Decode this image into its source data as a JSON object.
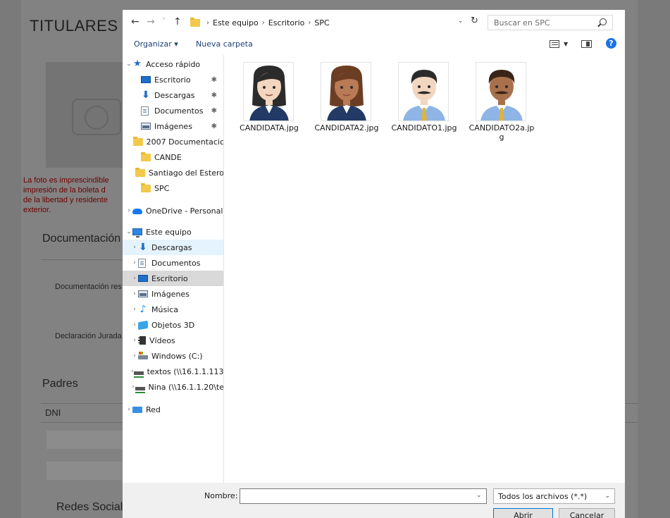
{
  "background_page": {
    "title": "TITULARES",
    "photo_warning": [
      "La foto es imprescindible",
      "impresión de la boleta d",
      "de la libertad y residente",
      "exterior."
    ],
    "section_documentacion": "Documentación",
    "label_doc_res": "Documentación res",
    "label_declaracion": "Declaración Jurada",
    "section_padres": "Padres",
    "label_dni": "DNI",
    "section_redes": "Redes Social"
  },
  "dialog": {
    "nav": {
      "back": "←",
      "forward": "→",
      "recent": "˅",
      "up": "↑"
    },
    "breadcrumb": [
      "Este equipo",
      "Escritorio",
      "SPC"
    ],
    "search_placeholder": "Buscar en SPC",
    "toolbar": {
      "organize": "Organizar ▾",
      "new_folder": "Nueva carpeta",
      "help": "?"
    },
    "nav_pane": [
      {
        "label": "Acceso rápido",
        "icon": "star-icon",
        "chevron": "⌄",
        "pinned": false
      },
      {
        "label": "Escritorio",
        "icon": "desktop-icon",
        "chevron": "",
        "pinned": true
      },
      {
        "label": "Descargas",
        "icon": "download-icon",
        "chevron": "",
        "pinned": true
      },
      {
        "label": "Documentos",
        "icon": "document-icon",
        "chevron": "",
        "pinned": true
      },
      {
        "label": "Imágenes",
        "icon": "images-icon",
        "chevron": "",
        "pinned": true
      },
      {
        "label": "2007 Documentacic",
        "icon": "folder-icon",
        "chevron": "",
        "pinned": false
      },
      {
        "label": "CANDE",
        "icon": "folder-icon",
        "chevron": "",
        "pinned": false
      },
      {
        "label": "Santiago del Estero",
        "icon": "folder-icon",
        "chevron": "",
        "pinned": false
      },
      {
        "label": "SPC",
        "icon": "folder-icon",
        "chevron": "",
        "pinned": false
      },
      {
        "label": "OneDrive - Personal",
        "icon": "cloud-icon",
        "chevron": "›",
        "pinned": false
      },
      {
        "label": "Este equipo",
        "icon": "computer-icon",
        "chevron": "⌄",
        "pinned": false
      },
      {
        "label": "Descargas",
        "icon": "download-icon",
        "chevron": "›",
        "pinned": false
      },
      {
        "label": "Documentos",
        "icon": "document-icon",
        "chevron": "›",
        "pinned": false
      },
      {
        "label": "Escritorio",
        "icon": "desktop-icon",
        "chevron": "›",
        "pinned": false
      },
      {
        "label": "Imágenes",
        "icon": "images-icon",
        "chevron": "›",
        "pinned": false
      },
      {
        "label": "Música",
        "icon": "music-icon",
        "chevron": "›",
        "pinned": false
      },
      {
        "label": "Objetos 3D",
        "icon": "cube-icon",
        "chevron": "›",
        "pinned": false
      },
      {
        "label": "Vídeos",
        "icon": "video-icon",
        "chevron": "›",
        "pinned": false
      },
      {
        "label": "Windows (C:)",
        "icon": "drive-icon",
        "chevron": "›",
        "pinned": false
      },
      {
        "label": "textos (\\\\16.1.1.113)",
        "icon": "network-drive-icon",
        "chevron": "›",
        "pinned": false
      },
      {
        "label": "Nina (\\\\16.1.1.20\\te",
        "icon": "network-drive-icon",
        "chevron": "›",
        "pinned": false
      },
      {
        "label": "Red",
        "icon": "network-icon",
        "chevron": "›",
        "pinned": false
      }
    ],
    "files": [
      {
        "name": "CANDIDATA.jpg",
        "icon": "woman-avatar-icon",
        "skin": "#f3d6c0",
        "hair": "#2b2b2b",
        "clothes": "#233a66"
      },
      {
        "name": "CANDIDATA2.jpg",
        "icon": "woman-avatar-icon",
        "skin": "#b97a56",
        "hair": "#6b3e24",
        "clothes": "#233a66"
      },
      {
        "name": "CANDIDATO1.jpg",
        "icon": "man-avatar-icon",
        "skin": "#f3d6c0",
        "hair": "#2b2b2b",
        "clothes": "#8fb4e6"
      },
      {
        "name": "CANDIDATO2a.jpg",
        "icon": "man-avatar-icon",
        "skin": "#a8704c",
        "hair": "#3a2418",
        "clothes": "#8fb4e6"
      }
    ],
    "bottom": {
      "name_label": "Nombre:",
      "name_value": "",
      "file_type": "Todos los archivos (*.*)",
      "open_button": "Abrir",
      "cancel_button": "Cancelar"
    }
  }
}
